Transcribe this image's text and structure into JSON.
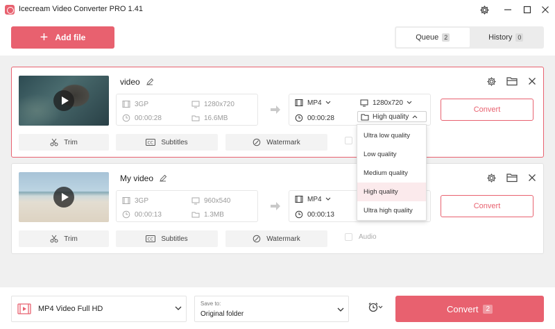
{
  "window": {
    "title": "Icecream Video Converter PRO 1.41"
  },
  "toolbar": {
    "add_file_label": "Add file",
    "tabs": [
      {
        "label": "Queue",
        "count": "2",
        "active": true
      },
      {
        "label": "History",
        "count": "0",
        "active": false
      }
    ]
  },
  "files": [
    {
      "name": "video",
      "source": {
        "format": "3GP",
        "resolution": "1280x720",
        "duration": "00:00:28",
        "size": "16.6MB"
      },
      "output": {
        "format": "MP4",
        "resolution": "1280x720",
        "duration": "00:00:28",
        "quality": "High quality"
      },
      "convert_label": "Convert",
      "trim_label": "Trim",
      "subtitles_label": "Subtitles",
      "watermark_label": "Watermark"
    },
    {
      "name": "My video",
      "source": {
        "format": "3GP",
        "resolution": "960x540",
        "duration": "00:00:13",
        "size": "1.3MB"
      },
      "output": {
        "format": "MP4",
        "duration": "00:00:13"
      },
      "convert_label": "Convert",
      "trim_label": "Trim",
      "subtitles_label": "Subtitles",
      "watermark_label": "Watermark",
      "audio_label": "Audio"
    }
  ],
  "quality_dropdown": {
    "options": [
      "Ultra low quality",
      "Low quality",
      "Medium quality",
      "High quality",
      "Ultra high quality"
    ],
    "selected": "High quality"
  },
  "bottom_bar": {
    "preset": "MP4 Video Full HD",
    "save_to_label": "Save to:",
    "save_to_value": "Original folder",
    "convert_label": "Convert",
    "convert_count": "2"
  },
  "colors": {
    "accent": "#e8616f",
    "highlight": "#fbeaec"
  }
}
